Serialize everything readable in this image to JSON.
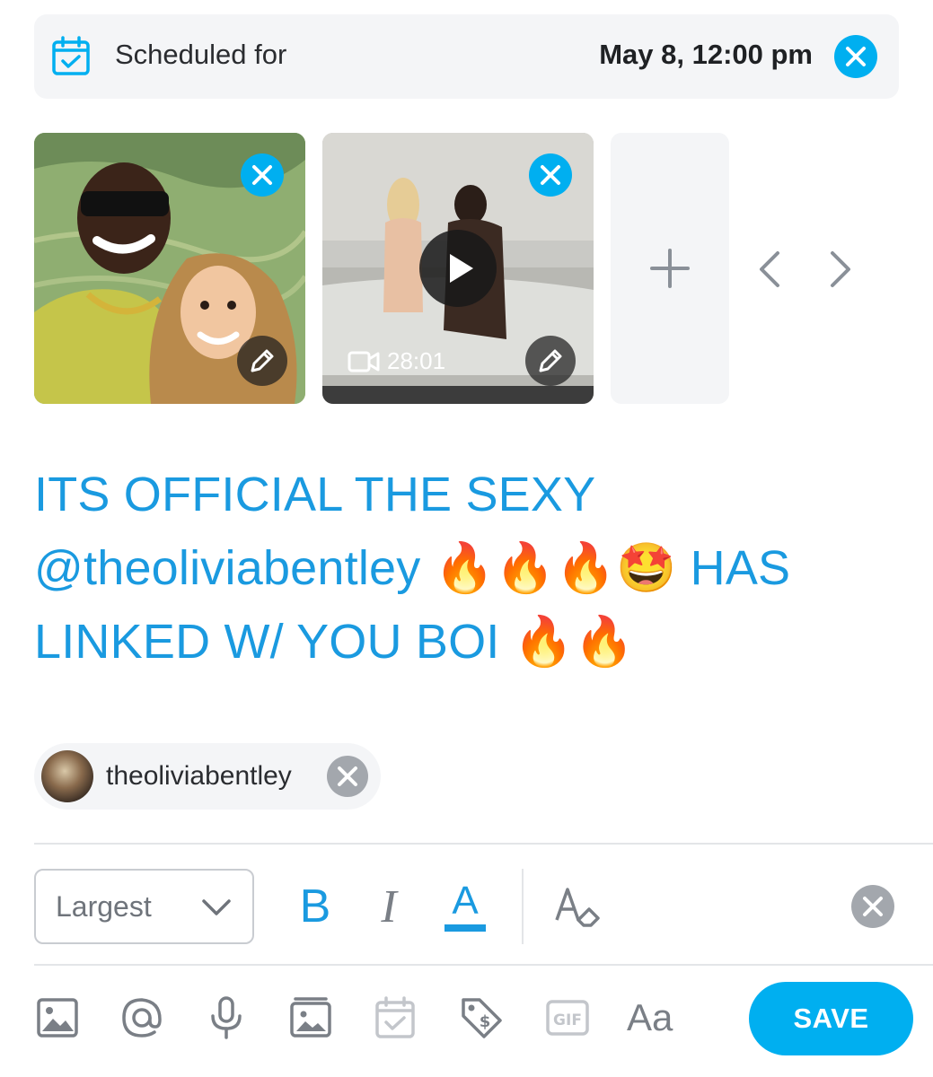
{
  "schedule": {
    "label": "Scheduled for",
    "date": "May 8, 12:00 pm",
    "icon": "calendar-check-icon",
    "accent": "#00aff0"
  },
  "media": [
    {
      "type": "image",
      "description_icon": "pencil-icon"
    },
    {
      "type": "video",
      "duration": "28:01",
      "description_icon": "pencil-icon"
    }
  ],
  "post": {
    "text": "ITS OFFICIAL THE SEXY @theoliviabentley 🔥🔥🔥🤩 HAS LINKED W/ YOU BOI 🔥🔥",
    "color": "#1a9ae0"
  },
  "tag": {
    "name": "theoliviabentley"
  },
  "format": {
    "size": "Largest",
    "bold": "B",
    "italic": "I",
    "color_letter": "A"
  },
  "toolbar": {
    "icons": [
      "image-icon",
      "mention-icon",
      "microphone-icon",
      "vault-icon",
      "schedule-icon",
      "price-tag-icon",
      "gif-icon",
      "text-format-icon"
    ],
    "text_format_label": "Aa",
    "save_label": "SAVE"
  }
}
